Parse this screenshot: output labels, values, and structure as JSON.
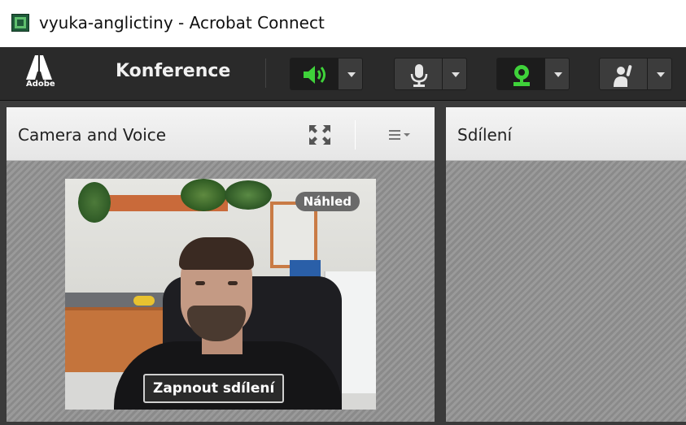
{
  "window": {
    "title": "vyuka-anglictiny - Acrobat Connect",
    "icon": "connect-app-icon"
  },
  "toolbar": {
    "logo_text": "Adobe",
    "app_name": "Konference",
    "buttons": [
      {
        "icon": "speaker-icon",
        "state": "on",
        "color": "#3fd23a"
      },
      {
        "icon": "microphone-icon",
        "state": "off",
        "color": "#e6e6e6"
      },
      {
        "icon": "webcam-icon",
        "state": "on",
        "color": "#3fd23a"
      },
      {
        "icon": "raise-hand-icon",
        "state": "off",
        "color": "#e6e6e6"
      }
    ]
  },
  "pods": {
    "camera": {
      "title": "Camera and Voice",
      "preview_badge": "Náhled",
      "share_button": "Zapnout sdílení"
    },
    "share": {
      "title": "Sdílení"
    }
  },
  "colors": {
    "toolbar_bg": "#2a2a2a",
    "active_green": "#3fd23a"
  }
}
